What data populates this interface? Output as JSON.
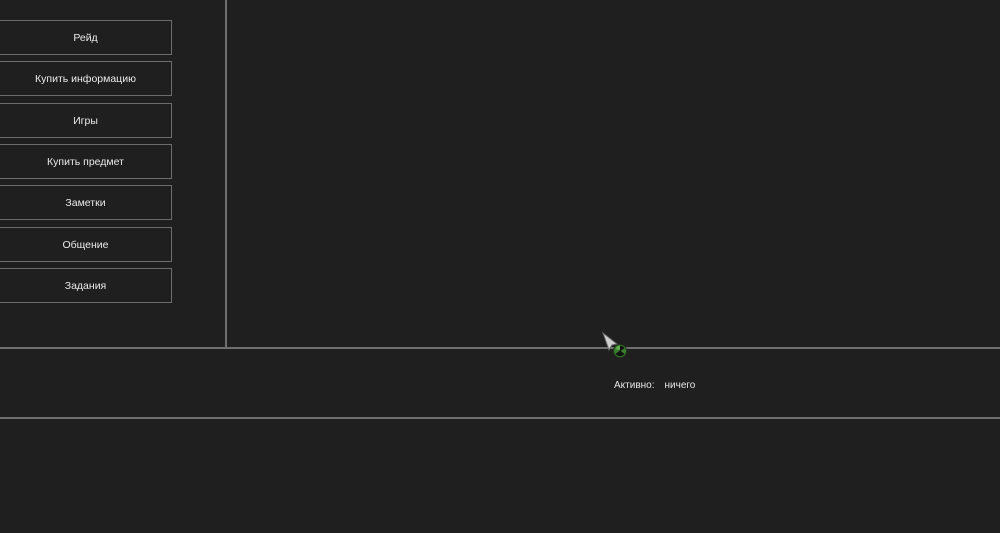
{
  "sidebar": {
    "items": [
      {
        "label": "Рейд"
      },
      {
        "label": "Купить информацию"
      },
      {
        "label": "Игры"
      },
      {
        "label": "Купить предмет"
      },
      {
        "label": "Заметки"
      },
      {
        "label": "Общение"
      },
      {
        "label": "Задания"
      }
    ]
  },
  "status": {
    "label": "Активно:",
    "value": "ничего"
  },
  "colors": {
    "background": "#1f1f1f",
    "border": "#6d6d6d",
    "text": "#e6e6e6",
    "cursor_accent": "#4caf3a"
  },
  "icons": {
    "cursor": "radiation-cursor-icon"
  }
}
